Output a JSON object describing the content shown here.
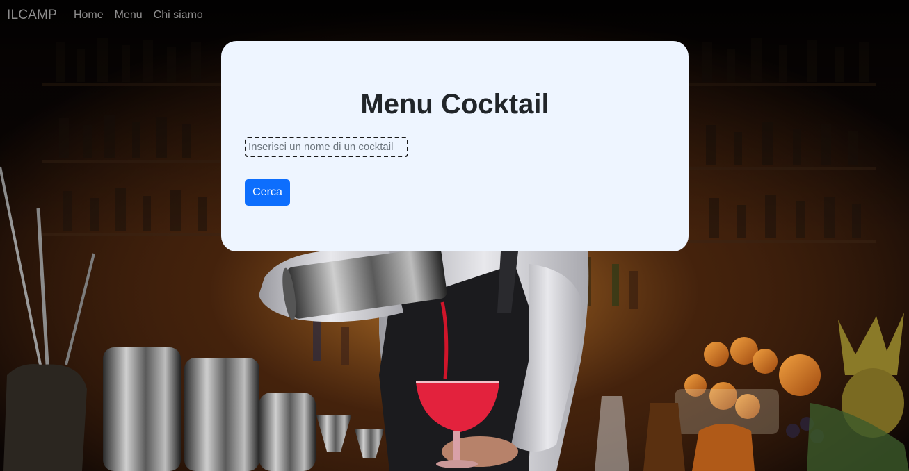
{
  "navbar": {
    "brand": "ILCAMP",
    "links": [
      {
        "label": "Home"
      },
      {
        "label": "Menu"
      },
      {
        "label": "Chi siamo"
      }
    ]
  },
  "card": {
    "title": "Menu Cocktail",
    "search_placeholder": "Inserisci un nome di un cocktail",
    "search_value": "",
    "button_label": "Cerca"
  },
  "colors": {
    "card_background": "#eef5ff",
    "primary_button": "#0d6efd",
    "title_text": "#212529",
    "nav_text": "rgba(255,255,255,0.55)"
  },
  "background": {
    "description_icon": "bartender-pouring-cocktail-photo"
  }
}
